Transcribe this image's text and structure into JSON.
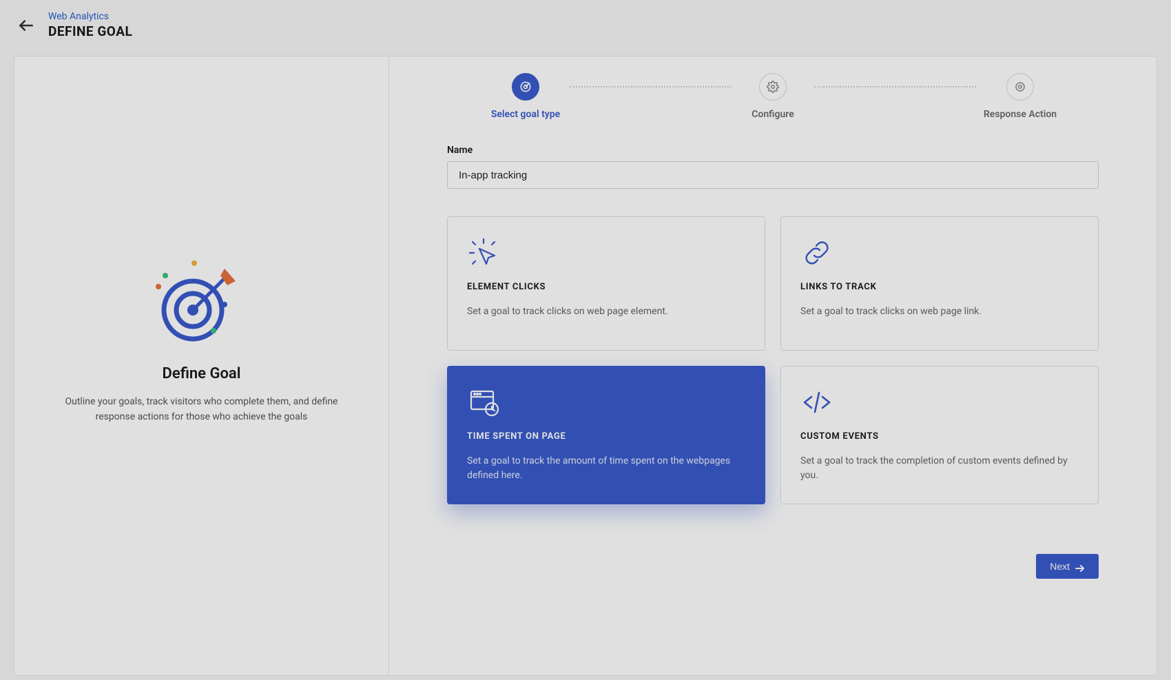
{
  "header": {
    "breadcrumb": "Web Analytics",
    "title": "DEFINE GOAL"
  },
  "left": {
    "heading": "Define Goal",
    "description": "Outline your goals, track visitors who complete them, and define response actions for those who achieve the goals"
  },
  "stepper": {
    "steps": [
      {
        "label": "Select goal type",
        "active": true
      },
      {
        "label": "Configure",
        "active": false
      },
      {
        "label": "Response Action",
        "active": false
      }
    ]
  },
  "form": {
    "name_label": "Name",
    "name_value": "In-app tracking"
  },
  "cards": [
    {
      "key": "element-clicks",
      "title": "ELEMENT CLICKS",
      "desc": "Set a goal to track clicks on web page element.",
      "selected": false,
      "icon": "cursor-click-icon"
    },
    {
      "key": "links-to-track",
      "title": "LINKS TO TRACK",
      "desc": "Set a goal to track clicks on web page link.",
      "selected": false,
      "icon": "link-icon"
    },
    {
      "key": "time-spent",
      "title": "TIME SPENT ON PAGE",
      "desc": "Set a goal to track the amount of time spent on the webpages defined here.",
      "selected": true,
      "icon": "browser-clock-icon"
    },
    {
      "key": "custom-events",
      "title": "CUSTOM EVENTS",
      "desc": "Set a goal to track the completion of custom events defined by you.",
      "selected": false,
      "icon": "code-icon"
    }
  ],
  "actions": {
    "next_label": "Next"
  },
  "colors": {
    "accent": "#3a5bcc"
  }
}
